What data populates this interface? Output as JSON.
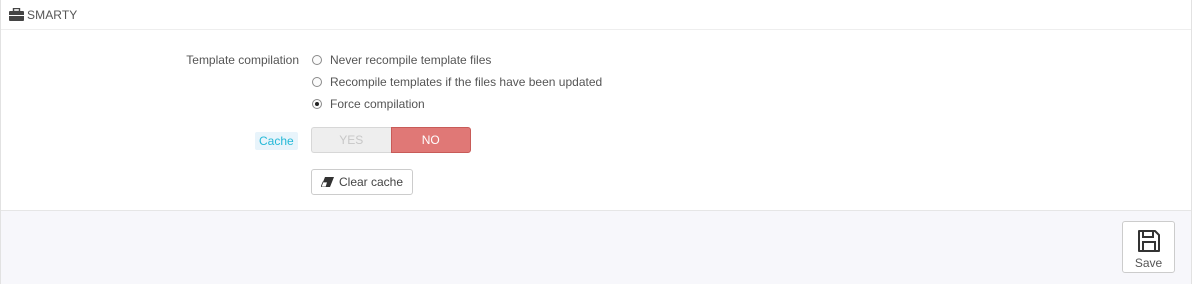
{
  "panel": {
    "title": "SMARTY",
    "title_icon": "briefcase-icon"
  },
  "form": {
    "template_compilation": {
      "label": "Template compilation",
      "options": [
        {
          "label": "Never recompile template files",
          "checked": false
        },
        {
          "label": "Recompile templates if the files have been updated",
          "checked": false
        },
        {
          "label": "Force compilation",
          "checked": true
        }
      ]
    },
    "cache": {
      "label": "Cache",
      "yes_label": "YES",
      "no_label": "NO",
      "value": "NO",
      "no_color": "#e07876"
    },
    "clear_cache": {
      "label": "Clear cache",
      "icon": "eraser-icon"
    }
  },
  "footer": {
    "save_label": "Save",
    "save_icon": "floppy-disk-icon"
  }
}
